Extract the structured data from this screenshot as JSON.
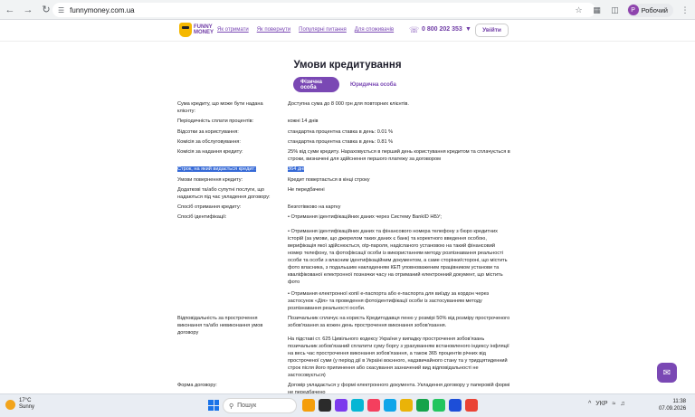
{
  "browser": {
    "url": "funnymoney.com.ua",
    "profile_initial": "Р",
    "profile_name": "Робочий"
  },
  "site": {
    "logo_line1": "FUNNY",
    "logo_line2": "MONEY",
    "nav": [
      "Як отримати",
      "Як повернути",
      "Популярні питання",
      "Для споживачів"
    ],
    "phone": "0 800 202 353",
    "login": "Увійти"
  },
  "page": {
    "title": "Умови кредитування",
    "tabs": [
      {
        "label": "Фізична особа",
        "active": true
      },
      {
        "label": "Юридична особа",
        "active": false
      }
    ],
    "rows": [
      {
        "key": "Сума кредиту, що може бути надана клієнту:",
        "value": "Доступна сума до 8 000 грн для повторних клієнтів."
      },
      {
        "key": "Періодичність сплати процентів:",
        "value": "кожні 14 днів"
      },
      {
        "key": "Відсотки за користування:",
        "value": "стандартна процентна ставка в день: 0.01 %"
      },
      {
        "key": "Комісія за обслуговування:",
        "value": "стандартна процентна ставка в день: 0.81 %"
      },
      {
        "key": "Комісія за надання кредиту:",
        "value": "25% від суми кредиту. Нараховується в перший день користування кредитом та сплачується в строки, визначені для здійснення першого платежу за договором"
      },
      {
        "key": "Строк, на який видається кредит:",
        "value": "364 дні"
      },
      {
        "key": "Умови повернення кредиту:",
        "value": "Кредит повертається в кінці строку"
      },
      {
        "key": "Додаткові та/або супутні послуги, що надаються під час укладення договору:",
        "value": "Не передбачені"
      },
      {
        "key": "Спосіб отримання кредиту:",
        "value": "Безготівково на картку"
      },
      {
        "key": "Спосіб ідентифікації:",
        "value": "• Отримання ідентифікаційних даних через Систему BankID НБУ;"
      },
      {
        "key": "",
        "value": "• Отримання ідентифікаційних даних та фінансового номера телефону з бюро кредитних історій (за умови, що джерелом таких даних є банк) та коректного введення особою, верифікація якої здійснюється, otp-пароля, надісланого установою на такий фінансовий номер телефону, та фотофіксації особи із використанням методу розпізнавання реальності особи та особи з власним ідентифікаційним документом, а саме сторінки/стороні, що містить фото власника, з подальшим накладенням КЕП уповноваженим працівником установи та кваліфікованої електронної позначки часу на отриманий електронний документ, що містить фото"
      },
      {
        "key": "",
        "value": "• Отримання електронної копії е-паспорта або е-паспорта для виїзду за кордон через застосунок «Дія» та проведення фотоідентифікації особи із застосуванням методу розпізнавання реальності особи."
      },
      {
        "key": "Відповідальність за прострочення виконання та/або невиконання умов договору",
        "value": "Позичальник сплачує на користь Кредитодавця пеню у розмірі 50% від розміру простроченого зобов'язання за кожен день прострочення виконання зобов'язання."
      },
      {
        "key": "",
        "value": "На підставі ст. 625 Цивільного кодексу України у випадку прострочення зобов'язань позичальник зобов'язаний сплатити суму боргу з урахуванням встановленого індексу інфляції на весь час прострочення виконання зобов'язання, а також 365 процентів річних від простроченої суми (у період дії в Україні воєнного, надзвичайного стану та у тридцятиденний строк після його припинення або скасування зазначений вид відповідальності не застосовується)"
      },
      {
        "key": "Форма договору:",
        "value": "Договір укладається у формі електронного документа. Укладення договору у паперовій формі не передбачено"
      }
    ]
  },
  "taskbar": {
    "temperature": "17°C",
    "weather": "Sunny",
    "search": "Пошук",
    "lang": "УКР",
    "time": "11:38",
    "date": "07.09.2026"
  },
  "colors": {
    "brand": "#7a48b4",
    "highlight": "#3569d6",
    "logo_yellow": "#f5b800"
  }
}
